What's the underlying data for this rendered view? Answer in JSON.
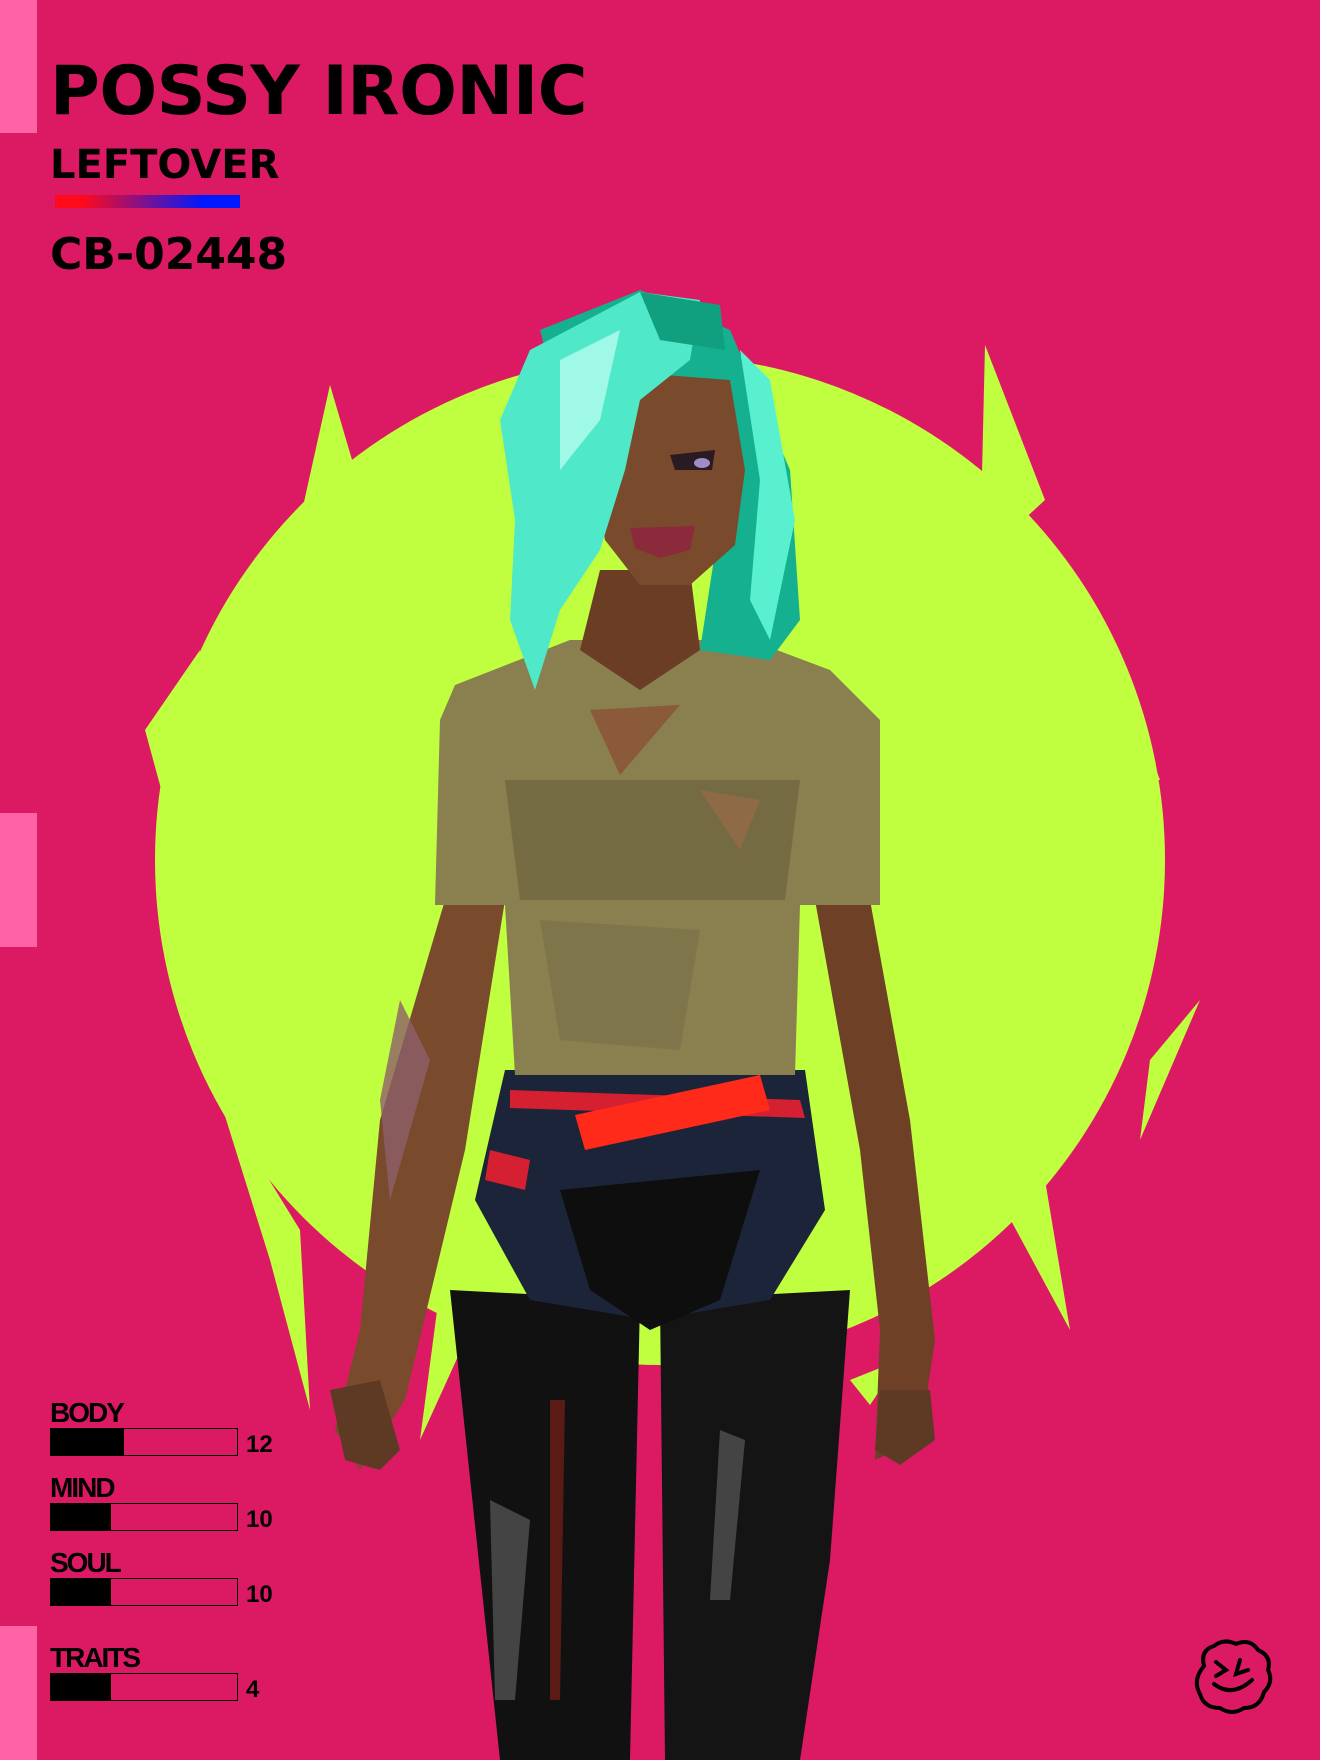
{
  "character": {
    "name": "POSSY IRONIC",
    "class": "LEFTOVER",
    "id": "CB-02448"
  },
  "stats": [
    {
      "label": "BODY",
      "value": "12",
      "fill": 0.39
    },
    {
      "label": "MIND",
      "value": "10",
      "fill": 0.32
    },
    {
      "label": "SOUL",
      "value": "10",
      "fill": 0.32
    },
    {
      "label": "TRAITS",
      "value": "4",
      "fill": 0.32
    }
  ],
  "colors": {
    "background": "#dc1a64",
    "accent_tab": "#ff62a5",
    "halo": "#c0ff3f",
    "hair": "#4fe8c8",
    "shirt": "#8a7f4e",
    "skin": "#7a4a2c",
    "gradient_start": "#ff0a1a",
    "gradient_end": "#0019ff"
  },
  "icons": {
    "logo": "smiley-face-logo-icon"
  }
}
